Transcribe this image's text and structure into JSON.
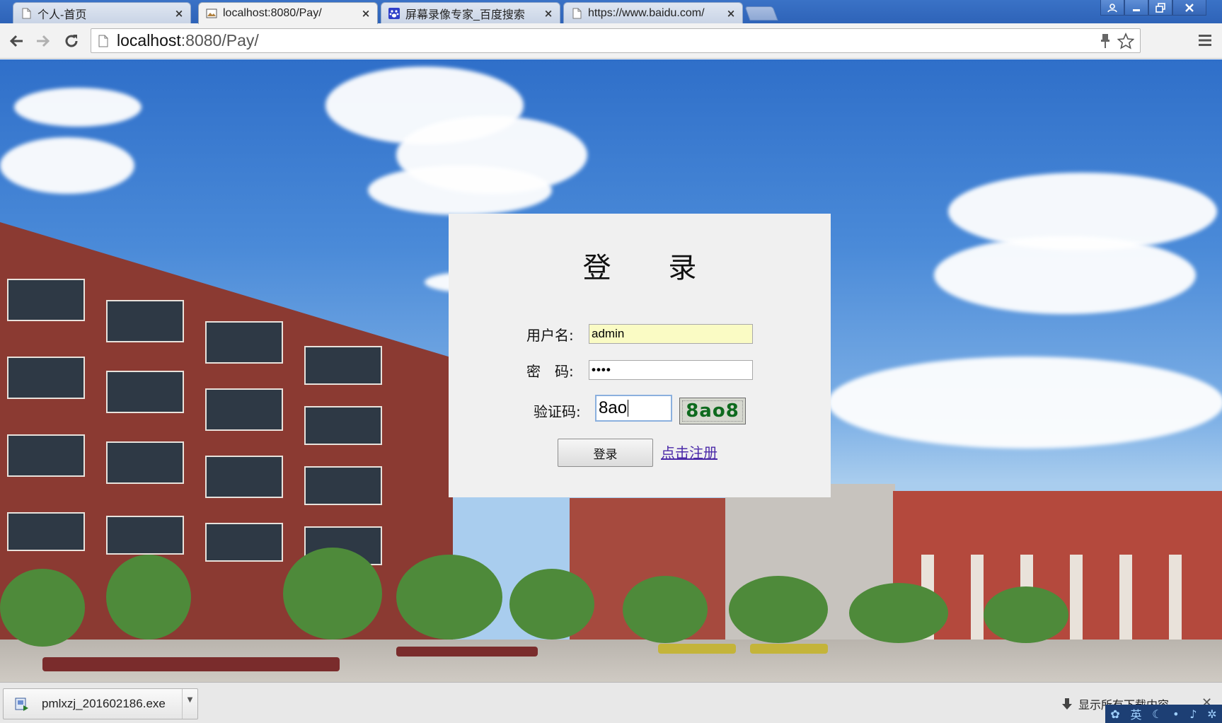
{
  "browser": {
    "tabs": [
      {
        "title": "个人-首页",
        "icon": "page-icon",
        "active": false
      },
      {
        "title": "localhost:8080/Pay/",
        "icon": "picture-icon",
        "active": true
      },
      {
        "title": "屏幕录像专家_百度搜索",
        "icon": "baidu-paw-icon",
        "active": false
      },
      {
        "title": "https://www.baidu.com/",
        "icon": "page-icon",
        "active": false
      }
    ],
    "close_glyph": "×",
    "address": {
      "host": "localhost",
      "rest": ":8080/Pay/"
    },
    "window_controls": [
      "user-icon",
      "minimize-icon",
      "restore-icon",
      "close-icon"
    ]
  },
  "login": {
    "title": "登 录",
    "username_label": "用户名:",
    "username_value": "admin",
    "password_label": "密　码:",
    "password_value": "••••",
    "captcha_label": "验证码:",
    "captcha_value": "8ao",
    "captcha_image_text": "8ao8",
    "submit_label": "登录",
    "register_link": "点击注册"
  },
  "downloads": {
    "file_name": "pmlxzj_201602186.exe",
    "show_all_label": "显示所有下载内容..."
  },
  "ime": {
    "label": "英"
  },
  "colors": {
    "tabstrip": "#2e63b8",
    "panel": "#f0f0f0",
    "autofill": "#fafbc4",
    "captcha_text": "#0e6a1e",
    "link": "#4b2aa8"
  }
}
